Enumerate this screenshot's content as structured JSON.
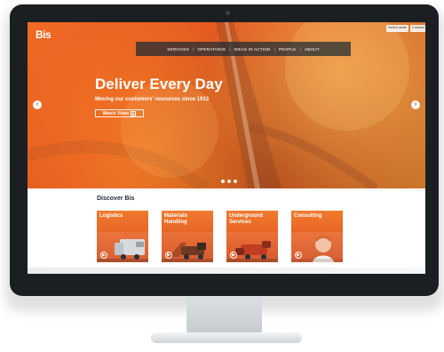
{
  "brand": {
    "logo_text": "Bis"
  },
  "utility": {
    "buttons": [
      "Select state",
      "Contact"
    ]
  },
  "nav": {
    "items": [
      "SERVICES",
      "OPERATIONS",
      "IDEAS IN ACTION",
      "PEOPLE",
      "ABOUT"
    ]
  },
  "hero": {
    "headline": "Deliver Every Day",
    "tagline": "Moving our customers' resources since 1913",
    "cta": "Watch Video",
    "cta_icon": "play-icon",
    "carousel_dots": 3,
    "active_dot": 0
  },
  "discover": {
    "title": "Discover Bis",
    "cards": [
      {
        "label": "Logistics",
        "icon": "truck-image"
      },
      {
        "label": "Materials Handling",
        "icon": "machinery-image"
      },
      {
        "label": "Underground Services",
        "icon": "mining-vehicle-image"
      },
      {
        "label": "Consulting",
        "icon": "person-image"
      }
    ]
  },
  "colors": {
    "accent": "#e45a20",
    "nav_bg": "#1b2933",
    "card_orange": "#f07a2e"
  }
}
